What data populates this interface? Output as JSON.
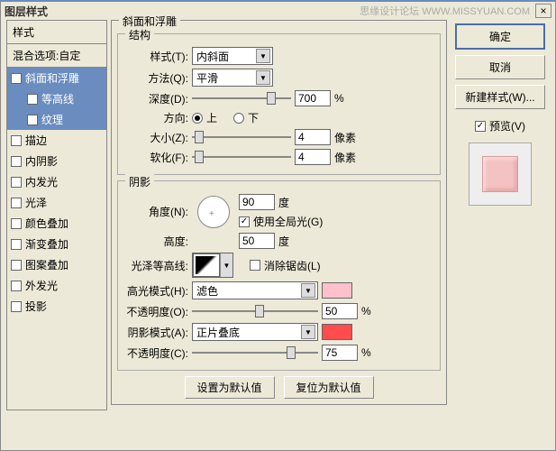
{
  "title": "图层样式",
  "watermark": "思缘设计论坛  WWW.MISSYUAN.COM",
  "close_icon": "×",
  "left": {
    "header": "样式",
    "blend": "混合选项:自定",
    "items": [
      {
        "label": "斜面和浮雕",
        "checked": true,
        "selected": true
      },
      {
        "label": "等高线",
        "checked": false,
        "indent": true,
        "sub": true
      },
      {
        "label": "纹理",
        "checked": false,
        "indent": true,
        "sub": true
      },
      {
        "label": "描边",
        "checked": false
      },
      {
        "label": "内阴影",
        "checked": false
      },
      {
        "label": "内发光",
        "checked": false
      },
      {
        "label": "光泽",
        "checked": false
      },
      {
        "label": "颜色叠加",
        "checked": false
      },
      {
        "label": "渐变叠加",
        "checked": false
      },
      {
        "label": "图案叠加",
        "checked": false
      },
      {
        "label": "外发光",
        "checked": false
      },
      {
        "label": "投影",
        "checked": false
      }
    ]
  },
  "bevel": {
    "title": "斜面和浮雕",
    "structure": {
      "title": "结构",
      "style_lbl": "样式(T):",
      "style_val": "内斜面",
      "method_lbl": "方法(Q):",
      "method_val": "平滑",
      "depth_lbl": "深度(D):",
      "depth_val": "700",
      "depth_unit": "%",
      "dir_lbl": "方向:",
      "up": "上",
      "down": "下",
      "size_lbl": "大小(Z):",
      "size_val": "4",
      "size_unit": "像素",
      "soften_lbl": "软化(F):",
      "soften_val": "4",
      "soften_unit": "像素"
    },
    "shading": {
      "title": "阴影",
      "angle_lbl": "角度(N):",
      "angle_val": "90",
      "angle_unit": "度",
      "global_lbl": "使用全局光(G)",
      "alt_lbl": "高度:",
      "alt_val": "50",
      "alt_unit": "度",
      "gloss_lbl": "光泽等高线:",
      "antialias_lbl": "消除锯齿(L)",
      "hmode_lbl": "高光模式(H):",
      "hmode_val": "滤色",
      "hcolor": "#FFC0CB",
      "hop_lbl": "不透明度(O):",
      "hop_val": "50",
      "hop_unit": "%",
      "smode_lbl": "阴影模式(A):",
      "smode_val": "正片叠底",
      "scolor": "#FF4D4D",
      "sop_lbl": "不透明度(C):",
      "sop_val": "75",
      "sop_unit": "%"
    },
    "default_btn": "设置为默认值",
    "reset_btn": "复位为默认值"
  },
  "right": {
    "ok": "确定",
    "cancel": "取消",
    "newstyle": "新建样式(W)...",
    "preview_lbl": "预览(V)"
  }
}
